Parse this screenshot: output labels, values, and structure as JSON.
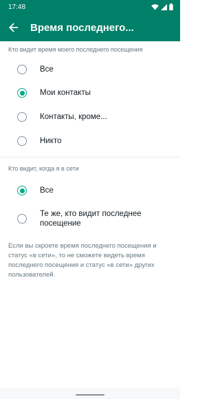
{
  "status_bar": {
    "time": "17:48",
    "icons": [
      "wifi-icon",
      "signal-icon",
      "battery-icon"
    ]
  },
  "app_bar": {
    "title": "Время последнего...",
    "back_icon": "arrow-left-icon"
  },
  "last_seen": {
    "header": "Кто видит время моего последнего посещения",
    "options": [
      {
        "label": "Все",
        "selected": false
      },
      {
        "label": "Мои контакты",
        "selected": true
      },
      {
        "label": "Контакты, кроме...",
        "selected": false
      },
      {
        "label": "Никто",
        "selected": false
      }
    ]
  },
  "online": {
    "header": "Кто видит, когда я в сети",
    "options": [
      {
        "label": "Все",
        "selected": true
      },
      {
        "label": "Те же, кто видит последнее посещение",
        "selected": false
      }
    ]
  },
  "footnote": "Если вы скроете время последнего посещения и статус «в сети», то не сможете видеть время последнего посещения и статус «в сети» других пользователей.",
  "colors": {
    "primary": "#008069",
    "accent": "#00a884",
    "secondary_text": "#667781"
  }
}
